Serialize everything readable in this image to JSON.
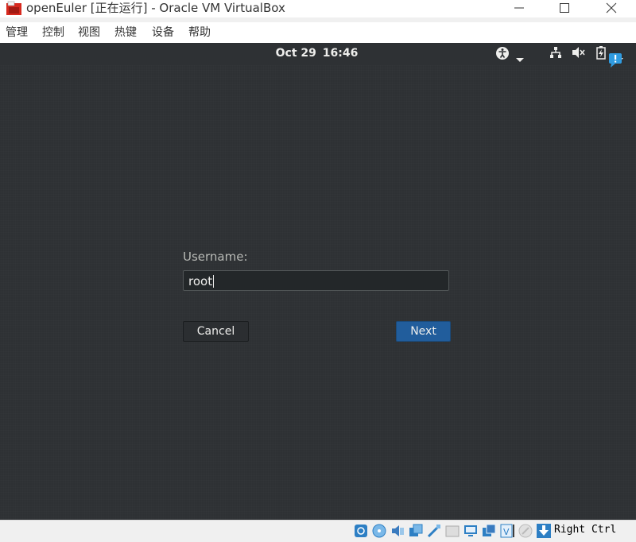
{
  "window": {
    "title": "openEuler [正在运行] - Oracle VM VirtualBox"
  },
  "menu": {
    "items": [
      "管理",
      "控制",
      "视图",
      "热键",
      "设备",
      "帮助"
    ]
  },
  "vm_topbar": {
    "date": "Oct 29",
    "time": "16:46",
    "tray_icons": [
      "accessibility-icon",
      "dropdown-arrow-icon",
      "network-wired-icon",
      "volume-muted-icon",
      "battery-charging-icon",
      "system-menu-arrow-icon",
      "notification-alert-icon"
    ]
  },
  "login": {
    "username_label": "Username:",
    "username_value": "root",
    "cancel_label": "Cancel",
    "next_label": "Next"
  },
  "statusbar": {
    "icons": [
      "hard-disk-icon",
      "optical-drive-icon",
      "audio-icon",
      "network-icon",
      "usb-icon",
      "shared-folders-icon",
      "display-icon",
      "video-capture-icon",
      "virtualization-icon",
      "mouse-integration-icon",
      "keyboard-capture-icon"
    ],
    "host_key": "Right Ctrl"
  },
  "colors": {
    "vm_background": "#2e3134",
    "primary_button": "#215d9c",
    "text_light": "#eeeeec"
  }
}
